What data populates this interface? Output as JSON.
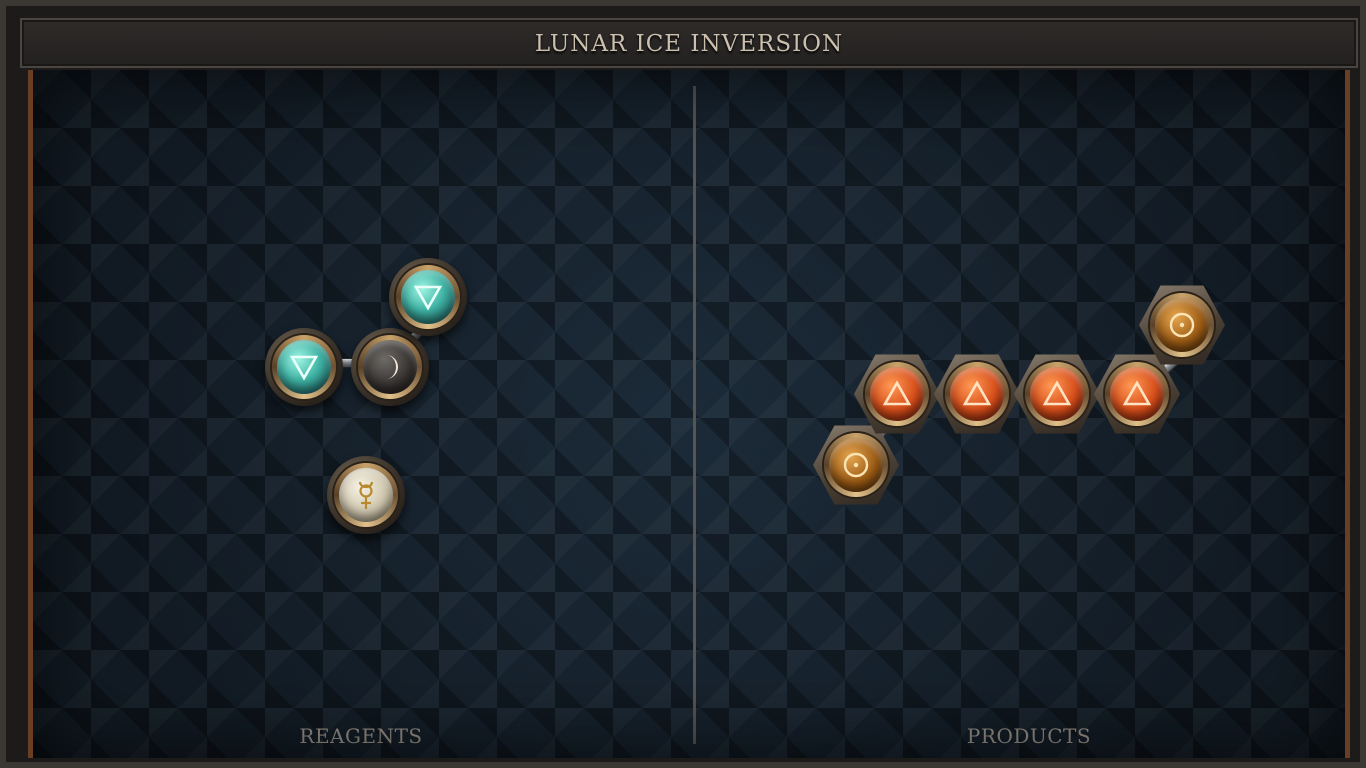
{
  "title": "LUNAR ICE INVERSION",
  "panels": {
    "reagents_label": "REAGENTS",
    "products_label": "PRODUCTS"
  },
  "colors": {
    "frame": "#3b3733",
    "board": "#17212c",
    "title_text": "#cbbfae",
    "water": "#3fb3a4",
    "fire": "#d8501c",
    "sun": "#9a5a14",
    "moon": "#332f2d",
    "mercury": "#cfc6ad"
  },
  "reagents": {
    "molecules": [
      {
        "name": "water-moon-water",
        "atoms": [
          {
            "element": "water",
            "icon": "water-triangle-icon",
            "symbol": "▽"
          },
          {
            "element": "moon",
            "icon": "moon-crescent-icon",
            "symbol": "☽"
          },
          {
            "element": "water",
            "icon": "water-triangle-icon",
            "symbol": "▽"
          }
        ],
        "bonds": 2
      },
      {
        "name": "mercury-single",
        "atoms": [
          {
            "element": "mercury",
            "icon": "mercury-icon",
            "symbol": "☿"
          }
        ],
        "bonds": 0
      }
    ]
  },
  "products": {
    "molecules": [
      {
        "name": "sun-fire-chain",
        "atoms": [
          {
            "element": "sun",
            "icon": "sun-circle-icon",
            "symbol": "☉"
          },
          {
            "element": "fire",
            "icon": "fire-triangle-icon",
            "symbol": "△"
          },
          {
            "element": "fire",
            "icon": "fire-triangle-icon",
            "symbol": "△"
          },
          {
            "element": "fire",
            "icon": "fire-triangle-icon",
            "symbol": "△"
          },
          {
            "element": "fire",
            "icon": "fire-triangle-icon",
            "symbol": "△"
          },
          {
            "element": "sun",
            "icon": "sun-circle-icon",
            "symbol": "☉"
          }
        ],
        "bonds": 5
      }
    ]
  }
}
